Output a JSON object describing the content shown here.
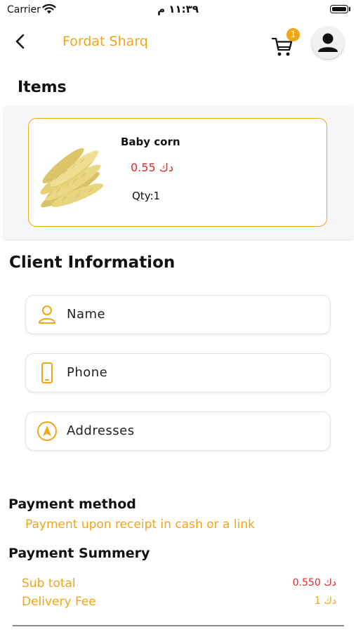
{
  "status_bar": {
    "carrier": "Carrier",
    "time": "١١:٣٩ م"
  },
  "header": {
    "title": "Fordat Sharq",
    "cart_count": "1"
  },
  "items_section": {
    "title": "Items",
    "items": [
      {
        "name": "Baby corn",
        "price": "دك 0.55",
        "qty": "Qty:1"
      }
    ]
  },
  "client_info": {
    "title": "Client Information",
    "fields": {
      "name": "Name",
      "phone": "Phone",
      "addresses": "Addresses"
    }
  },
  "payment_method": {
    "title": "Payment method",
    "value": "Payment upon receipt in cash or a link"
  },
  "payment_summary": {
    "title": "Payment Summery",
    "subtotal_label": "Sub total",
    "subtotal_value": "دك 0.550",
    "delivery_label": "Delivery Fee",
    "delivery_value": "دك 1"
  },
  "colors": {
    "accent": "#f2a516",
    "price": "#e02828"
  },
  "icons": [
    "wifi-icon",
    "battery-icon",
    "back-arrow-icon",
    "cart-icon",
    "user-avatar-icon",
    "person-icon",
    "phone-icon",
    "location-arrow-icon"
  ]
}
